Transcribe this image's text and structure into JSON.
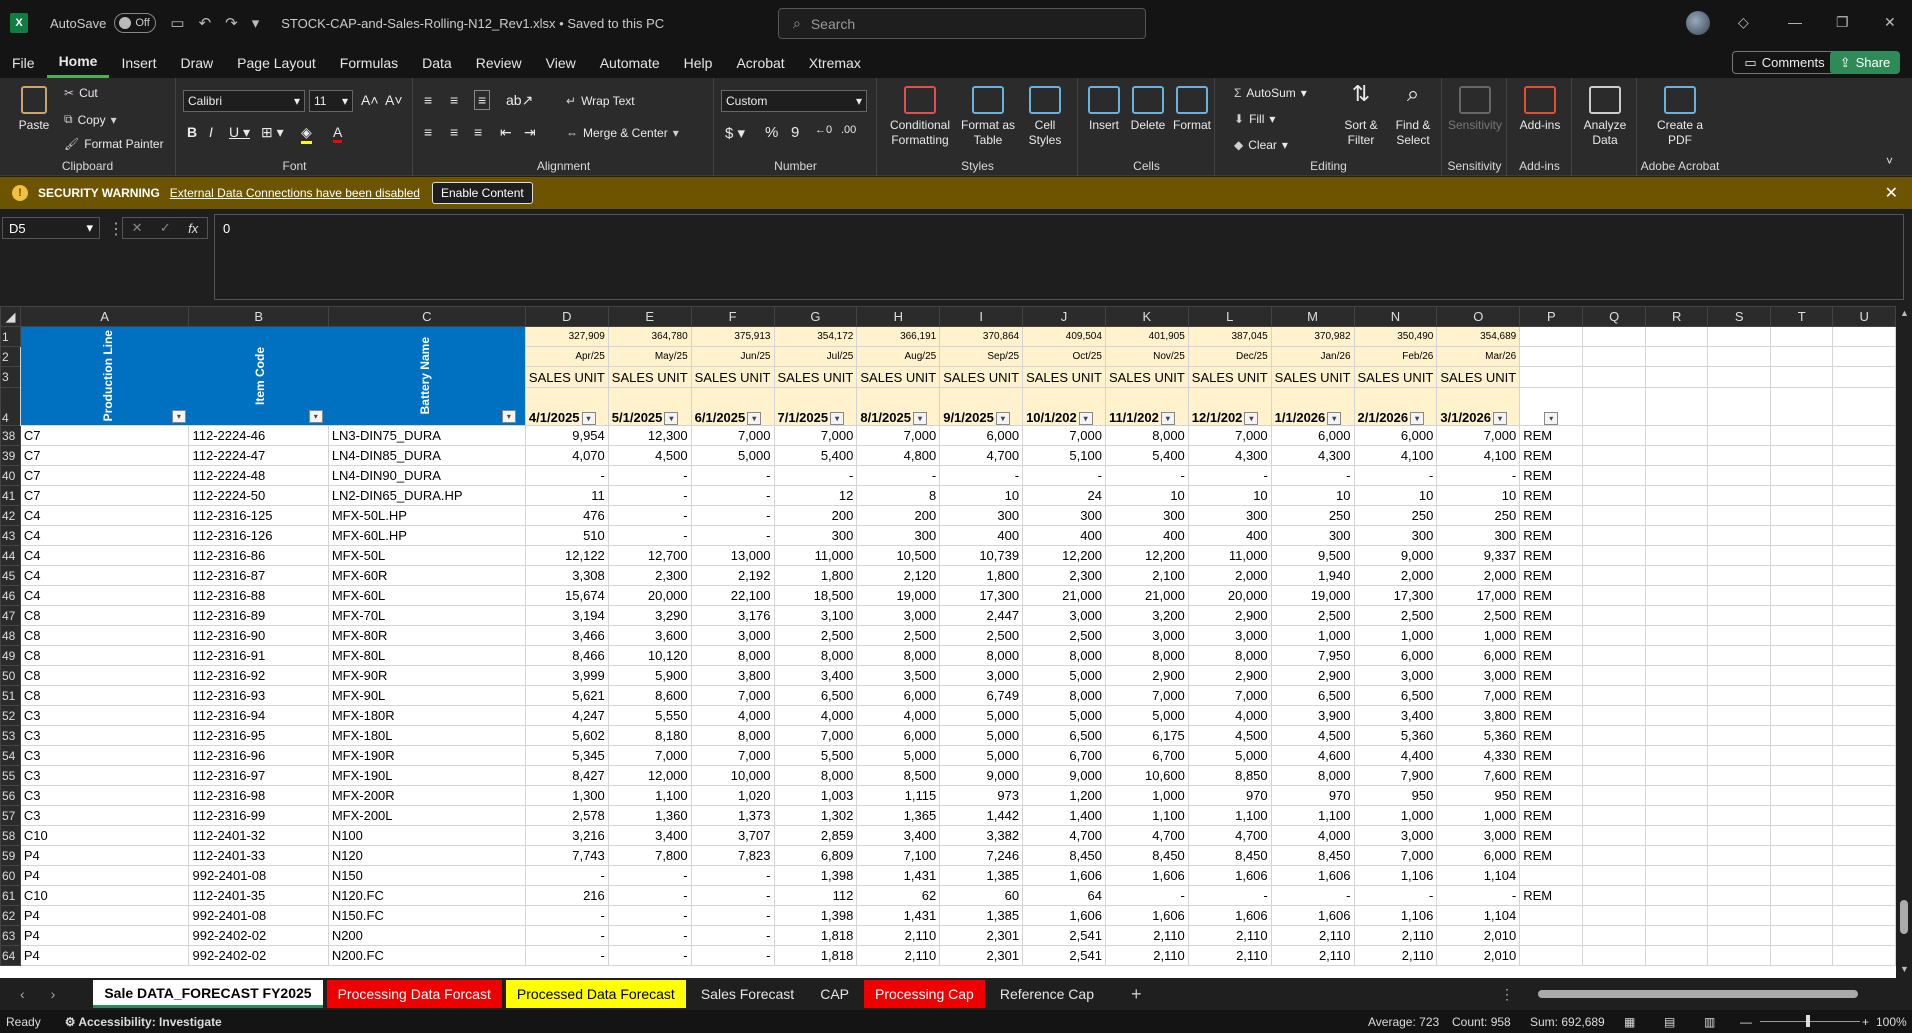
{
  "title_bar": {
    "autosave_label": "AutoSave",
    "autosave_state": "Off",
    "filename": "STOCK-CAP-and-Sales-Rolling-N12_Rev1.xlsx  •  Saved to this PC",
    "search_placeholder": "Search"
  },
  "menu": [
    "File",
    "Home",
    "Insert",
    "Draw",
    "Page Layout",
    "Formulas",
    "Data",
    "Review",
    "View",
    "Automate",
    "Help",
    "Acrobat",
    "Xtremax"
  ],
  "comments_label": "Comments",
  "share_label": "Share",
  "ribbon": {
    "clipboard": {
      "paste": "Paste",
      "cut": "Cut",
      "copy": "Copy",
      "format_painter": "Format Painter",
      "label": "Clipboard"
    },
    "font": {
      "name": "Calibri",
      "size": "11",
      "label": "Font"
    },
    "alignment": {
      "wrap": "Wrap Text",
      "merge": "Merge & Center",
      "label": "Alignment"
    },
    "number": {
      "format": "Custom",
      "label": "Number"
    },
    "styles": {
      "cond": "Conditional Formatting",
      "table": "Format as Table",
      "cell": "Cell Styles",
      "label": "Styles"
    },
    "cells": {
      "insert": "Insert",
      "delete": "Delete",
      "format": "Format",
      "label": "Cells"
    },
    "editing": {
      "autosum": "AutoSum",
      "fill": "Fill",
      "clear": "Clear",
      "sort": "Sort & Filter",
      "find": "Find & Select",
      "label": "Editing"
    },
    "sensitivity": {
      "btn": "Sensitivity",
      "label": "Sensitivity"
    },
    "addins": {
      "btn": "Add-ins",
      "label": "Add-ins"
    },
    "analyze": {
      "btn": "Analyze Data"
    },
    "acrobat": {
      "btn": "Create a PDF",
      "label": "Adobe Acrobat"
    }
  },
  "security": {
    "title": "SECURITY WARNING",
    "message": "External Data Connections have been disabled",
    "button": "Enable Content"
  },
  "formula_bar": {
    "cell_ref": "D5",
    "content": "0"
  },
  "columns": [
    "A",
    "B",
    "C",
    "D",
    "E",
    "F",
    "G",
    "H",
    "I",
    "J",
    "K",
    "L",
    "M",
    "N",
    "O",
    "P",
    "Q",
    "R",
    "S",
    "T",
    "U"
  ],
  "header_rows": {
    "row1_totals": [
      "327,909",
      "364,780",
      "375,913",
      "354,172",
      "366,191",
      "370,864",
      "409,504",
      "401,905",
      "387,045",
      "370,982",
      "350,490",
      "354,689"
    ],
    "row2_months": [
      "Apr/25",
      "May/25",
      "Jun/25",
      "Jul/25",
      "Aug/25",
      "Sep/25",
      "Oct/25",
      "Nov/25",
      "Dec/25",
      "Jan/26",
      "Feb/26",
      "Mar/26"
    ],
    "row3_label": "SALES UNIT",
    "row4_dates": [
      "4/1/2025",
      "5/1/2025",
      "6/1/2025",
      "7/1/2025",
      "8/1/2025",
      "9/1/2025",
      "10/1/202",
      "11/1/202",
      "12/1/202",
      "1/1/2026",
      "2/1/2026",
      "3/1/2026"
    ],
    "vertical_headers": [
      "Production Line",
      "Item Code",
      "Battery Name"
    ]
  },
  "rows": [
    {
      "n": "38",
      "a": "C7",
      "b": "112-2224-46",
      "c": "LN3-DIN75_DURA",
      "v": [
        "9,954",
        "12,300",
        "7,000",
        "7,000",
        "7,000",
        "6,000",
        "7,000",
        "8,000",
        "7,000",
        "6,000",
        "6,000",
        "7,000"
      ],
      "p": "REM"
    },
    {
      "n": "39",
      "a": "C7",
      "b": "112-2224-47",
      "c": "LN4-DIN85_DURA",
      "v": [
        "4,070",
        "4,500",
        "5,000",
        "5,400",
        "4,800",
        "4,700",
        "5,100",
        "5,400",
        "4,300",
        "4,300",
        "4,100",
        "4,100"
      ],
      "p": "REM"
    },
    {
      "n": "40",
      "a": "C7",
      "b": "112-2224-48",
      "c": "LN4-DIN90_DURA",
      "v": [
        "-",
        "-",
        "-",
        "-",
        "-",
        "-",
        "-",
        "-",
        "-",
        "-",
        "-",
        "-"
      ],
      "p": "REM"
    },
    {
      "n": "41",
      "a": "C7",
      "b": "112-2224-50",
      "c": "LN2-DIN65_DURA.HP",
      "v": [
        "11",
        "-",
        "-",
        "12",
        "8",
        "10",
        "24",
        "10",
        "10",
        "10",
        "10",
        "10"
      ],
      "p": "REM"
    },
    {
      "n": "42",
      "a": "C4",
      "b": "112-2316-125",
      "c": "MFX-50L.HP",
      "v": [
        "476",
        "-",
        "-",
        "200",
        "200",
        "300",
        "300",
        "300",
        "300",
        "250",
        "250",
        "250"
      ],
      "p": "REM"
    },
    {
      "n": "43",
      "a": "C4",
      "b": "112-2316-126",
      "c": "MFX-60L.HP",
      "v": [
        "510",
        "-",
        "-",
        "300",
        "300",
        "400",
        "400",
        "400",
        "400",
        "300",
        "300",
        "300"
      ],
      "p": "REM"
    },
    {
      "n": "44",
      "a": "C4",
      "b": "112-2316-86",
      "c": "MFX-50L",
      "v": [
        "12,122",
        "12,700",
        "13,000",
        "11,000",
        "10,500",
        "10,739",
        "12,200",
        "12,200",
        "11,000",
        "9,500",
        "9,000",
        "9,337"
      ],
      "p": "REM"
    },
    {
      "n": "45",
      "a": "C4",
      "b": "112-2316-87",
      "c": "MFX-60R",
      "v": [
        "3,308",
        "2,300",
        "2,192",
        "1,800",
        "2,120",
        "1,800",
        "2,300",
        "2,100",
        "2,000",
        "1,940",
        "2,000",
        "2,000"
      ],
      "p": "REM"
    },
    {
      "n": "46",
      "a": "C4",
      "b": "112-2316-88",
      "c": "MFX-60L",
      "v": [
        "15,674",
        "20,000",
        "22,100",
        "18,500",
        "19,000",
        "17,300",
        "21,000",
        "21,000",
        "20,000",
        "19,000",
        "17,300",
        "17,000"
      ],
      "p": "REM"
    },
    {
      "n": "47",
      "a": "C8",
      "b": "112-2316-89",
      "c": "MFX-70L",
      "v": [
        "3,194",
        "3,290",
        "3,176",
        "3,100",
        "3,000",
        "2,447",
        "3,000",
        "3,200",
        "2,900",
        "2,500",
        "2,500",
        "2,500"
      ],
      "p": "REM"
    },
    {
      "n": "48",
      "a": "C8",
      "b": "112-2316-90",
      "c": "MFX-80R",
      "v": [
        "3,466",
        "3,600",
        "3,000",
        "2,500",
        "2,500",
        "2,500",
        "2,500",
        "3,000",
        "3,000",
        "1,000",
        "1,000",
        "1,000"
      ],
      "p": "REM"
    },
    {
      "n": "49",
      "a": "C8",
      "b": "112-2316-91",
      "c": "MFX-80L",
      "v": [
        "8,466",
        "10,120",
        "8,000",
        "8,000",
        "8,000",
        "8,000",
        "8,000",
        "8,000",
        "8,000",
        "7,950",
        "6,000",
        "6,000"
      ],
      "p": "REM"
    },
    {
      "n": "50",
      "a": "C8",
      "b": "112-2316-92",
      "c": "MFX-90R",
      "v": [
        "3,999",
        "5,900",
        "3,800",
        "3,400",
        "3,500",
        "3,000",
        "5,000",
        "2,900",
        "2,900",
        "2,900",
        "3,000",
        "3,000"
      ],
      "p": "REM"
    },
    {
      "n": "51",
      "a": "C8",
      "b": "112-2316-93",
      "c": "MFX-90L",
      "v": [
        "5,621",
        "8,600",
        "7,000",
        "6,500",
        "6,000",
        "6,749",
        "8,000",
        "7,000",
        "7,000",
        "6,500",
        "6,500",
        "7,000"
      ],
      "p": "REM"
    },
    {
      "n": "52",
      "a": "C3",
      "b": "112-2316-94",
      "c": "MFX-180R",
      "v": [
        "4,247",
        "5,550",
        "4,000",
        "4,000",
        "4,000",
        "5,000",
        "5,000",
        "5,000",
        "4,000",
        "3,900",
        "3,400",
        "3,800"
      ],
      "p": "REM"
    },
    {
      "n": "53",
      "a": "C3",
      "b": "112-2316-95",
      "c": "MFX-180L",
      "v": [
        "5,602",
        "8,180",
        "8,000",
        "7,000",
        "6,000",
        "5,000",
        "6,500",
        "6,175",
        "4,500",
        "4,500",
        "5,360",
        "5,360"
      ],
      "p": "REM"
    },
    {
      "n": "54",
      "a": "C3",
      "b": "112-2316-96",
      "c": "MFX-190R",
      "v": [
        "5,345",
        "7,000",
        "7,000",
        "5,500",
        "5,000",
        "5,000",
        "6,700",
        "6,700",
        "5,000",
        "4,600",
        "4,400",
        "4,330"
      ],
      "p": "REM"
    },
    {
      "n": "55",
      "a": "C3",
      "b": "112-2316-97",
      "c": "MFX-190L",
      "v": [
        "8,427",
        "12,000",
        "10,000",
        "8,000",
        "8,500",
        "9,000",
        "9,000",
        "10,600",
        "8,850",
        "8,000",
        "7,900",
        "7,600"
      ],
      "p": "REM"
    },
    {
      "n": "56",
      "a": "C3",
      "b": "112-2316-98",
      "c": "MFX-200R",
      "v": [
        "1,300",
        "1,100",
        "1,020",
        "1,003",
        "1,115",
        "973",
        "1,200",
        "1,000",
        "970",
        "970",
        "950",
        "950"
      ],
      "p": "REM"
    },
    {
      "n": "57",
      "a": "C3",
      "b": "112-2316-99",
      "c": "MFX-200L",
      "v": [
        "2,578",
        "1,360",
        "1,373",
        "1,302",
        "1,365",
        "1,442",
        "1,400",
        "1,100",
        "1,100",
        "1,100",
        "1,000",
        "1,000"
      ],
      "p": "REM"
    },
    {
      "n": "58",
      "a": "C10",
      "b": "112-2401-32",
      "c": "N100",
      "v": [
        "3,216",
        "3,400",
        "3,707",
        "2,859",
        "3,400",
        "3,382",
        "4,700",
        "4,700",
        "4,700",
        "4,000",
        "3,000",
        "3,000"
      ],
      "p": "REM"
    },
    {
      "n": "59",
      "a": "P4",
      "b": "112-2401-33",
      "c": "N120",
      "v": [
        "7,743",
        "7,800",
        "7,823",
        "6,809",
        "7,100",
        "7,246",
        "8,450",
        "8,450",
        "8,450",
        "8,450",
        "7,000",
        "6,000"
      ],
      "p": "REM"
    },
    {
      "n": "60",
      "a": "P4",
      "b": "992-2401-08",
      "c": "N150",
      "v": [
        "-",
        "-",
        "-",
        "1,398",
        "1,431",
        "1,385",
        "1,606",
        "1,606",
        "1,606",
        "1,606",
        "1,106",
        "1,104"
      ],
      "p": ""
    },
    {
      "n": "61",
      "a": "C10",
      "b": "112-2401-35",
      "c": "N120.FC",
      "v": [
        "216",
        "-",
        "-",
        "112",
        "62",
        "60",
        "64",
        "-",
        "-",
        "-",
        "-",
        "-"
      ],
      "p": "REM"
    },
    {
      "n": "62",
      "a": "P4",
      "b": "992-2401-08",
      "c": "N150.FC",
      "v": [
        "-",
        "-",
        "-",
        "1,398",
        "1,431",
        "1,385",
        "1,606",
        "1,606",
        "1,606",
        "1,606",
        "1,106",
        "1,104"
      ],
      "p": ""
    },
    {
      "n": "63",
      "a": "P4",
      "b": "992-2402-02",
      "c": "N200",
      "v": [
        "-",
        "-",
        "-",
        "1,818",
        "2,110",
        "2,301",
        "2,541",
        "2,110",
        "2,110",
        "2,110",
        "2,110",
        "2,010"
      ],
      "p": ""
    },
    {
      "n": "64",
      "a": "P4",
      "b": "992-2402-02",
      "c": "N200.FC",
      "v": [
        "-",
        "-",
        "-",
        "1,818",
        "2,110",
        "2,301",
        "2,541",
        "2,110",
        "2,110",
        "2,110",
        "2,110",
        "2,010"
      ],
      "p": ""
    }
  ],
  "sheet_tabs": [
    {
      "label": "Sale DATA_FORECAST FY2025",
      "style": "active"
    },
    {
      "label": "Processing Data Forcast",
      "style": "red"
    },
    {
      "label": "Processed Data Forecast",
      "style": "yellow"
    },
    {
      "label": "Sales Forecast",
      "style": "normal"
    },
    {
      "label": "CAP",
      "style": "normal"
    },
    {
      "label": "Processing Cap",
      "style": "red"
    },
    {
      "label": "Reference Cap",
      "style": "normal"
    }
  ],
  "status": {
    "ready": "Ready",
    "accessibility": "Accessibility: Investigate",
    "average": "Average: 723",
    "count": "Count: 958",
    "sum": "Sum: 692,689",
    "zoom": "100%"
  },
  "colors": {
    "accent": "#2e8b57",
    "header_blue": "#0070c0",
    "header_yellow": "#fff2cc",
    "security_bar": "#6d5400",
    "tab_red": "#ee0000",
    "tab_yellow": "#ffff00"
  }
}
